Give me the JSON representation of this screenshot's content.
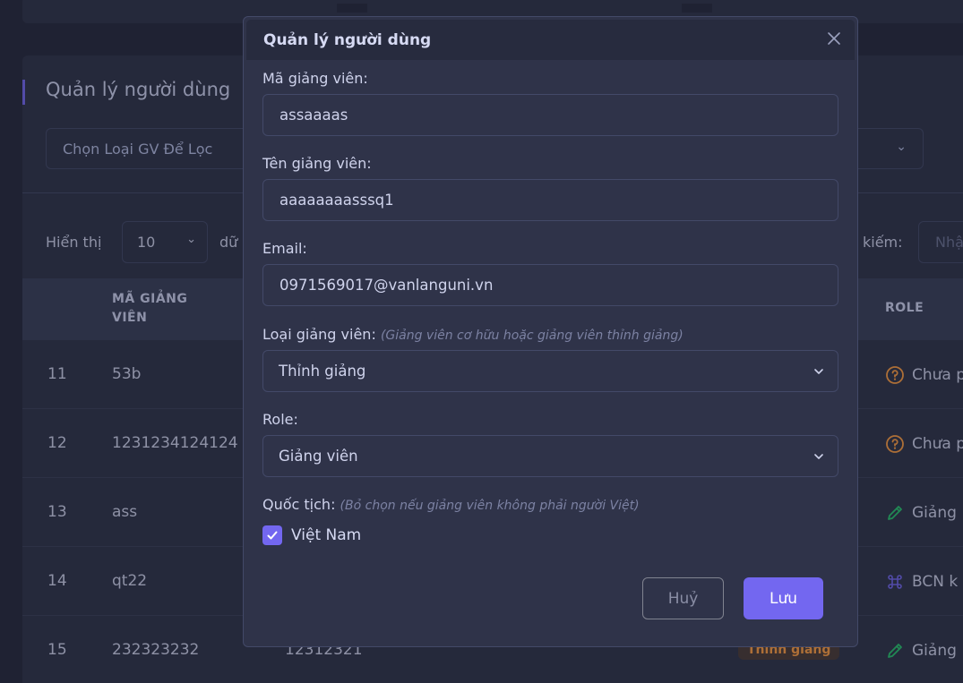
{
  "page": {
    "card_title": "Quản lý người dùng",
    "filter_placeholder": "Chọn Loại GV Để Lọc",
    "show_label": "Hiển thị",
    "page_size": "10",
    "data_label": "dữ",
    "search_label": "kiếm:",
    "search_placeholder": "Nhậ",
    "columns": {
      "code": "MÃ GIẢNG VIÊN",
      "role": "ROLE"
    },
    "rows": [
      {
        "index": "11",
        "code": "53b",
        "name": "",
        "badge": "",
        "role": "Chưa p",
        "role_icon": "question-circle-icon"
      },
      {
        "index": "12",
        "code": "1231234124124",
        "name": "",
        "badge": "",
        "role": "Chưa p",
        "role_icon": "question-circle-icon"
      },
      {
        "index": "13",
        "code": "ass",
        "name": "",
        "badge": "",
        "role": "Giảng",
        "role_icon": "pencil-icon"
      },
      {
        "index": "14",
        "code": "qt22",
        "name": "",
        "badge": "",
        "role": "BCN k",
        "role_icon": "command-icon"
      },
      {
        "index": "15",
        "code": "232323232",
        "name": "12312321",
        "badge": "Thỉnh giảng",
        "role": "Giảng",
        "role_icon": "pencil-icon"
      }
    ]
  },
  "modal": {
    "title": "Quản lý người dùng",
    "fields": {
      "code_label": "Mã giảng viên:",
      "code_value": "assaaaas",
      "name_label": "Tên giảng viên:",
      "name_value": "aaaaaaaasssq1",
      "email_label": "Email:",
      "email_value": "0971569017@vanlanguni.vn",
      "type_label": "Loại giảng viên:",
      "type_hint": "(Giảng viên cơ hữu hoặc giảng viên thỉnh giảng)",
      "type_value": "Thỉnh giảng",
      "role_label": "Role:",
      "role_value": "Giảng viên",
      "nationality_label": "Quốc tịch:",
      "nationality_hint": "(Bỏ chọn nếu giảng viên không phải người Việt)",
      "nationality_checkbox": "Việt Nam"
    },
    "buttons": {
      "cancel": "Huỷ",
      "save": "Lưu"
    }
  },
  "colors": {
    "background": "#25293c",
    "card": "#2f3349",
    "primary": "#7367f0",
    "warning": "#ff9f43",
    "success": "#28c76f"
  }
}
